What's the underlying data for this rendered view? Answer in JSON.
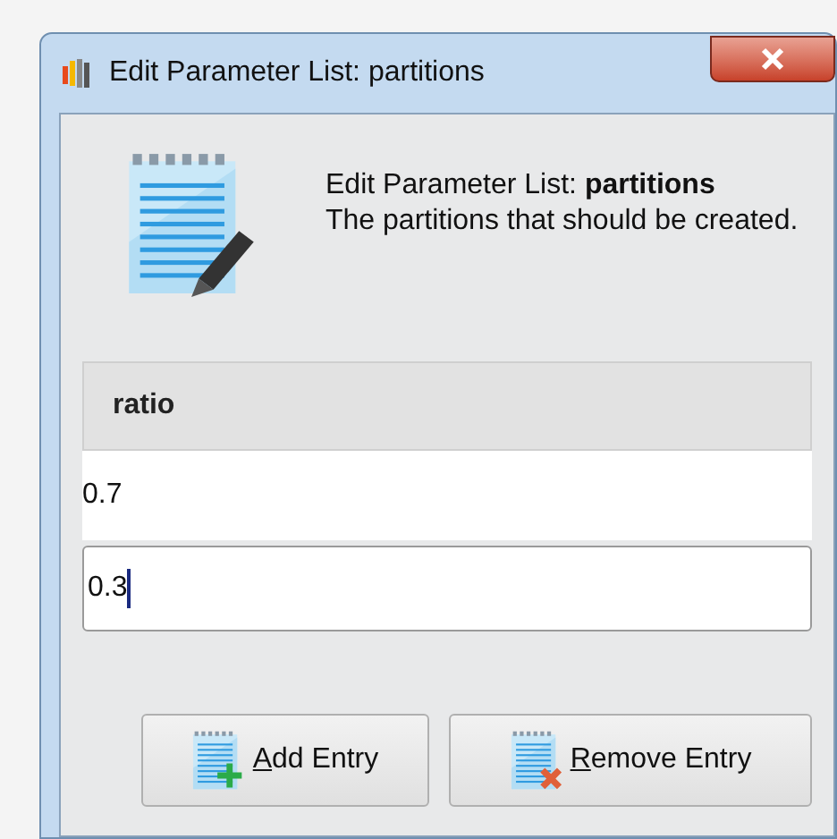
{
  "window": {
    "title": "Edit Parameter List: partitions"
  },
  "header": {
    "title": "Edit Parameter List: **partitions**",
    "description": "The partitions that should be created."
  },
  "table": {
    "columns": [
      "ratio"
    ],
    "rows": [
      {
        "value": "0.7",
        "editing": false
      },
      {
        "value": "0.3",
        "editing": true
      }
    ]
  },
  "buttons": [
    {
      "label": "Add Entry",
      "kind": "add"
    },
    {
      "label": "Remove Entry",
      "kind": "remove"
    }
  ]
}
